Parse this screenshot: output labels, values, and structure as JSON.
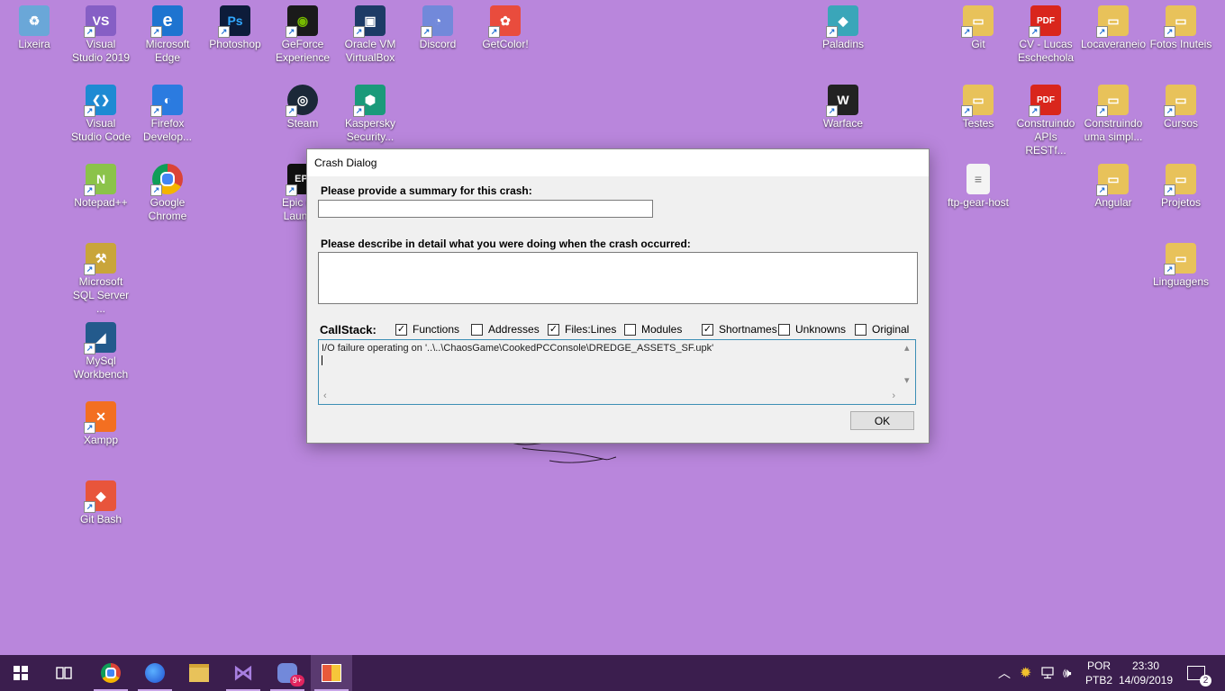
{
  "desktop": {
    "icons": [
      {
        "label": "Lixeira",
        "icon": "recycle-bin-icon",
        "color": "#6aa7d8",
        "glyph": "♻"
      },
      {
        "label": "Visual Studio 2019",
        "icon": "visual-studio-icon",
        "color": "#865fc5",
        "glyph": "VS"
      },
      {
        "label": "Microsoft Edge",
        "icon": "edge-icon",
        "color": "#1e74d0",
        "glyph": "e"
      },
      {
        "label": "Photoshop",
        "icon": "photoshop-icon",
        "color": "#0d1c3a",
        "glyph": "Ps"
      },
      {
        "label": "GeForce Experience",
        "icon": "geforce-icon",
        "color": "#1a1a1a",
        "glyph": "◉"
      },
      {
        "label": "Oracle VM VirtualBox",
        "icon": "virtualbox-icon",
        "color": "#1d3b66",
        "glyph": "▣"
      },
      {
        "label": "Discord",
        "icon": "discord-icon",
        "color": "#7289da",
        "glyph": "◔"
      },
      {
        "label": "GetColor!",
        "icon": "getcolor-icon",
        "color": "#e94c3d",
        "glyph": "✿"
      },
      {
        "label": "Paladins",
        "icon": "paladins-icon",
        "color": "#3aa6b9",
        "glyph": "◆"
      },
      {
        "label": "Git",
        "icon": "folder-icon",
        "color": "#e8c25a",
        "glyph": "▭"
      },
      {
        "label": "CV - Lucas Eschechola",
        "icon": "pdf-icon",
        "color": "#d9261c",
        "glyph": "PDF"
      },
      {
        "label": "Locaveraneio",
        "icon": "folder-icon",
        "color": "#e8c25a",
        "glyph": "▭"
      },
      {
        "label": "Fotos Inuteis",
        "icon": "folder-icon",
        "color": "#e8c25a",
        "glyph": "▭"
      },
      {
        "label": "Visual Studio Code",
        "icon": "vscode-icon",
        "color": "#1e8ad3",
        "glyph": "❮❯"
      },
      {
        "label": "Firefox Develop...",
        "icon": "firefox-dev-icon",
        "color": "#2b7be0",
        "glyph": "◐"
      },
      {
        "label": "Steam",
        "icon": "steam-icon",
        "color": "#1b2838",
        "glyph": "◎"
      },
      {
        "label": "Kaspersky Security...",
        "icon": "kaspersky-icon",
        "color": "#1a9a7a",
        "glyph": "⬢"
      },
      {
        "label": "Warface",
        "icon": "warface-icon",
        "color": "#222222",
        "glyph": "W"
      },
      {
        "label": "Testes",
        "icon": "folder-icon",
        "color": "#e8c25a",
        "glyph": "▭"
      },
      {
        "label": "Construindo APIs RESTf...",
        "icon": "pdf-icon",
        "color": "#d9261c",
        "glyph": "PDF"
      },
      {
        "label": "Construindo uma simpl...",
        "icon": "folder-icon",
        "color": "#e8c25a",
        "glyph": "▭"
      },
      {
        "label": "Cursos",
        "icon": "folder-icon",
        "color": "#e8c25a",
        "glyph": "▭"
      },
      {
        "label": "Notepad++",
        "icon": "notepadpp-icon",
        "color": "#8bc34a",
        "glyph": "N"
      },
      {
        "label": "Google Chrome",
        "icon": "chrome-icon",
        "color": "#db4437",
        "glyph": "◉"
      },
      {
        "label": "Epic G... Launc...",
        "icon": "epic-games-icon",
        "color": "#111111",
        "glyph": "EPI"
      },
      {
        "label": "ftp-gear-host",
        "icon": "file-icon",
        "color": "#f4f4f4",
        "glyph": "≡"
      },
      {
        "label": "Angular",
        "icon": "folder-icon",
        "color": "#e8c25a",
        "glyph": "▭"
      },
      {
        "label": "Projetos",
        "icon": "folder-icon",
        "color": "#e8c25a",
        "glyph": "▭"
      },
      {
        "label": "Microsoft SQL Server ...",
        "icon": "sql-server-icon",
        "color": "#c9a53a",
        "glyph": "⚒"
      },
      {
        "label": "Linguagens",
        "icon": "folder-icon",
        "color": "#e8c25a",
        "glyph": "▭"
      },
      {
        "label": "MySql Workbench",
        "icon": "mysql-workbench-icon",
        "color": "#235a8c",
        "glyph": "◢"
      },
      {
        "label": "Xampp",
        "icon": "xampp-icon",
        "color": "#f36f21",
        "glyph": "✕"
      },
      {
        "label": "Git Bash",
        "icon": "git-bash-icon",
        "color": "#e8553b",
        "glyph": "◆"
      }
    ]
  },
  "dialog": {
    "title": "Crash Dialog",
    "summary_label": "Please provide a summary for this crash:",
    "summary_value": "",
    "detail_label": "Please describe in detail what you were doing when the crash occurred:",
    "detail_value": "",
    "callstack_label": "CallStack:",
    "options": [
      {
        "label": "Functions",
        "checked": true
      },
      {
        "label": "Addresses",
        "checked": false
      },
      {
        "label": "Files:Lines",
        "checked": true
      },
      {
        "label": "Modules",
        "checked": false
      },
      {
        "label": "Shortnames",
        "checked": true
      },
      {
        "label": "Unknowns",
        "checked": false
      },
      {
        "label": "Original",
        "checked": false
      }
    ],
    "callstack_text": "I/O failure operating on '..\\..\\ChaosGame\\CookedPCConsole\\DREDGE_ASSETS_SF.upk'",
    "ok_label": "OK"
  },
  "taskbar": {
    "apps": [
      {
        "name": "start-button",
        "icon": "windows-icon"
      },
      {
        "name": "task-view-button",
        "icon": "task-view-icon"
      },
      {
        "name": "taskbar-chrome",
        "icon": "chrome-icon"
      },
      {
        "name": "taskbar-firefox",
        "icon": "firefox-icon"
      },
      {
        "name": "taskbar-file-explorer",
        "icon": "folder-icon"
      },
      {
        "name": "taskbar-visual-studio",
        "icon": "visual-studio-icon"
      },
      {
        "name": "taskbar-discord",
        "icon": "discord-icon"
      },
      {
        "name": "taskbar-crash-app",
        "icon": "app-window-icon"
      }
    ],
    "discord_badge": "9+",
    "lang_line1": "POR",
    "lang_line2": "PTB2",
    "time": "23:30",
    "date": "14/09/2019",
    "notification_count": "2"
  }
}
